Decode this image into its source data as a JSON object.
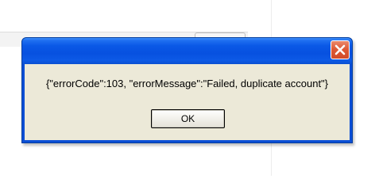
{
  "dialog": {
    "message": "{\"errorCode\":103, \"errorMessage\":\"Failed, duplicate account\"}",
    "ok_label": "OK",
    "close_icon": "close-icon"
  },
  "colors": {
    "title_bar": "#0751e0",
    "close_button": "#de5a37",
    "dialog_body": "#ece9d8"
  }
}
